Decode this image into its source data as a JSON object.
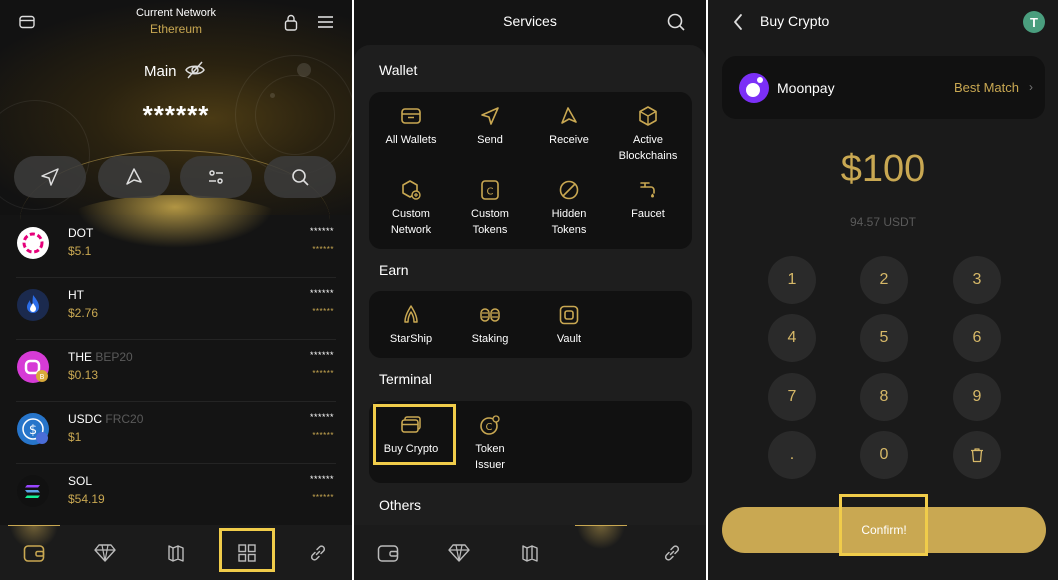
{
  "wallet": {
    "network_label": "Current Network",
    "network_value": "Ethereum",
    "account_name": "Main",
    "balance_masked": "******",
    "tokens": [
      {
        "symbol": "DOT",
        "chain": "",
        "price": "$5.1",
        "amount": "******",
        "value": "******",
        "logo_color": "#e6007a"
      },
      {
        "symbol": "HT",
        "chain": "",
        "price": "$2.76",
        "amount": "******",
        "value": "******",
        "logo_color": "#1b2a4e"
      },
      {
        "symbol": "THE",
        "chain": "BEP20",
        "price": "$0.13",
        "amount": "******",
        "value": "******",
        "logo_color": "#d63bd6"
      },
      {
        "symbol": "USDC",
        "chain": "FRC20",
        "price": "$1",
        "amount": "******",
        "value": "******",
        "logo_color": "#2775ca"
      },
      {
        "symbol": "SOL",
        "chain": "",
        "price": "$54.19",
        "amount": "******",
        "value": "******",
        "logo_color": "#111111"
      }
    ]
  },
  "services": {
    "title": "Services",
    "sections": {
      "wallet": "Wallet",
      "earn": "Earn",
      "terminal": "Terminal",
      "others": "Others"
    },
    "wallet_items": [
      "All Wallets",
      "Send",
      "Receive",
      "Active\nBlockchains",
      "Custom\nNetwork",
      "Custom\nTokens",
      "Hidden\nTokens",
      "Faucet"
    ],
    "earn_items": [
      "StarShip",
      "Staking",
      "Vault"
    ],
    "terminal_items": [
      "Buy Crypto",
      "Token\nIssuer"
    ]
  },
  "buy": {
    "title": "Buy Crypto",
    "token_badge": "T",
    "provider_name": "Moonpay",
    "provider_tag": "Best Match",
    "provider_chevron": "›",
    "amount": "$100",
    "converted": "94.57 USDT",
    "keys": [
      "1",
      "2",
      "3",
      "4",
      "5",
      "6",
      "7",
      "8",
      "9",
      ".",
      "0"
    ],
    "confirm_label": "Confirm!"
  },
  "colors": {
    "accent_gold": "#c9a852",
    "background": "#141414",
    "card": "#111111",
    "highlight": "#f0cc4a"
  },
  "icons": {
    "wallet_top_left": "wallet-icon",
    "lock": "lock-icon",
    "menu": "menu-icon",
    "hide_balance": "eye-off-icon",
    "usdt": "tether-icon",
    "delete": "trash-icon"
  }
}
